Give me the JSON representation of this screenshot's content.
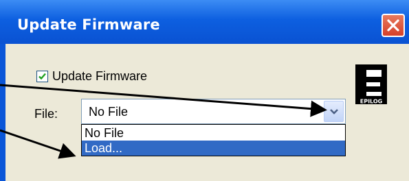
{
  "window": {
    "title": "Update Firmware",
    "close_icon": "close-icon"
  },
  "checkbox": {
    "label": "Update Firmware",
    "checked": true
  },
  "file": {
    "label": "File:",
    "selected": "No File",
    "options": [
      "No File",
      "Load..."
    ],
    "highlighted_index": 1
  },
  "logo": {
    "text": "EPILOG"
  },
  "colors": {
    "titlebar": "#0d5fe0",
    "client": "#ece9d8",
    "highlight": "#316ac5",
    "close": "#d5402a"
  }
}
